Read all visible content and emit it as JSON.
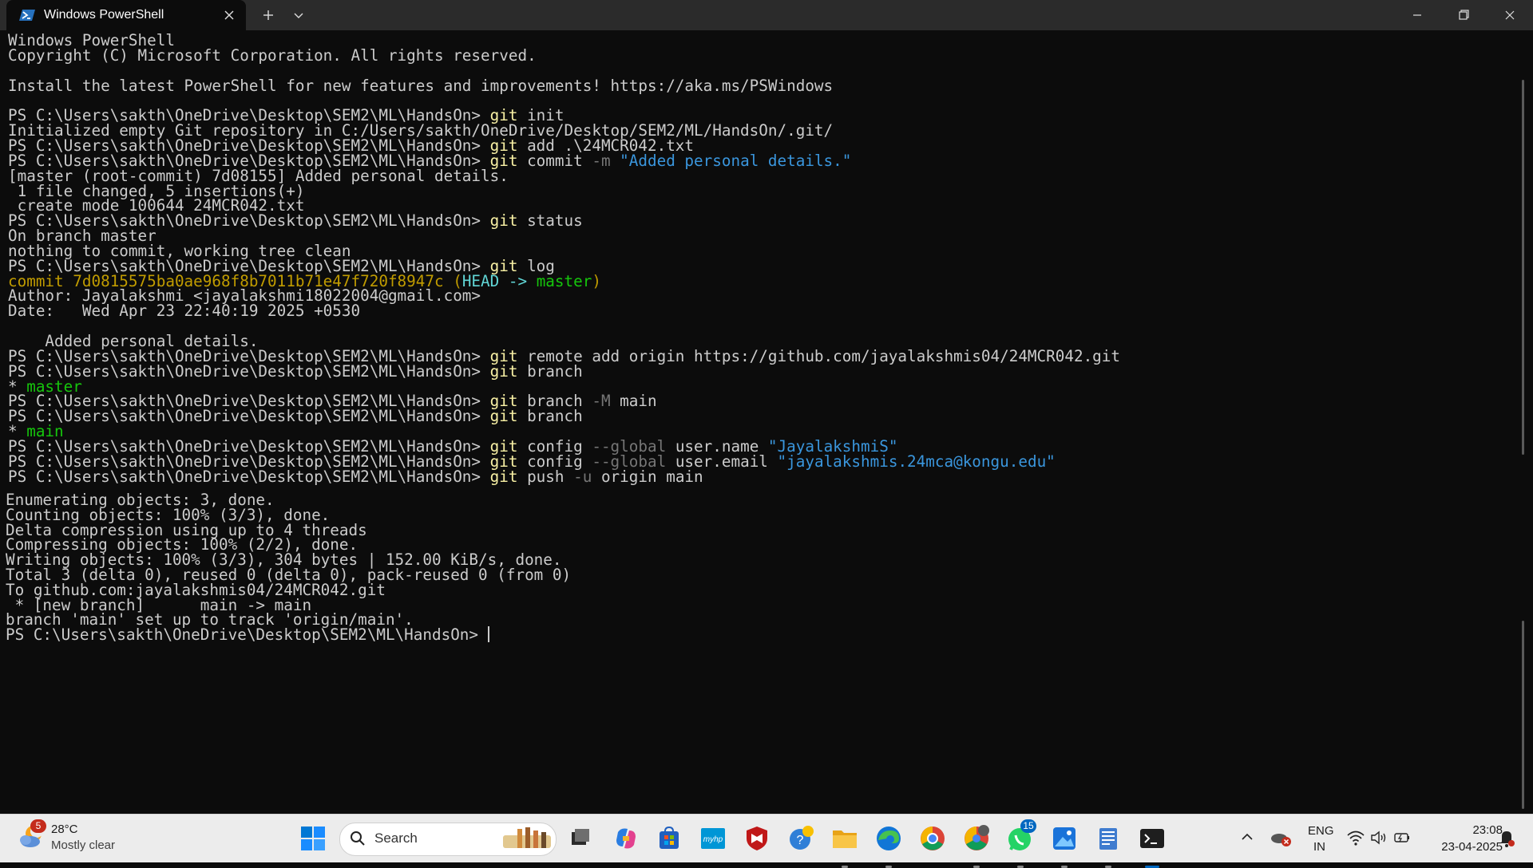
{
  "window": {
    "tab_title": "Windows PowerShell",
    "controls": [
      "minimize",
      "restore",
      "close"
    ]
  },
  "terminal": {
    "lines": [
      "Windows PowerShell",
      "Copyright (C) Microsoft Corporation. All rights reserved.",
      "",
      "Install the latest PowerShell for new features and improvements! https://aka.ms/PSWindows",
      "",
      "PS C:\\Users\\sakth\\OneDrive\\Desktop\\SEM2\\ML\\HandsOn> git init",
      "Initialized empty Git repository in C:/Users/sakth/OneDrive/Desktop/SEM2/ML/HandsOn/.git/",
      "PS C:\\Users\\sakth\\OneDrive\\Desktop\\SEM2\\ML\\HandsOn> git add .\\24MCR042.txt",
      "PS C:\\Users\\sakth\\OneDrive\\Desktop\\SEM2\\ML\\HandsOn> git commit -m \"Added personal details.\"",
      "[master (root-commit) 7d08155] Added personal details.",
      " 1 file changed, 5 insertions(+)",
      " create mode 100644 24MCR042.txt",
      "PS C:\\Users\\sakth\\OneDrive\\Desktop\\SEM2\\ML\\HandsOn> git status",
      "On branch master",
      "nothing to commit, working tree clean",
      "PS C:\\Users\\sakth\\OneDrive\\Desktop\\SEM2\\ML\\HandsOn> git log",
      "commit 7d0815575ba0ae968f8b7011b71e47f720f8947c (HEAD -> master)",
      "Author: Jayalakshmi <jayalakshmi18022004@gmail.com>",
      "Date:   Wed Apr 23 22:40:19 2025 +0530",
      "",
      "    Added personal details.",
      "PS C:\\Users\\sakth\\OneDrive\\Desktop\\SEM2\\ML\\HandsOn> git remote add origin https://github.com/jayalakshmis04/24MCR042.git",
      "PS C:\\Users\\sakth\\OneDrive\\Desktop\\SEM2\\ML\\HandsOn> git branch",
      "* master",
      "PS C:\\Users\\sakth\\OneDrive\\Desktop\\SEM2\\ML\\HandsOn> git branch -M main",
      "PS C:\\Users\\sakth\\OneDrive\\Desktop\\SEM2\\ML\\HandsOn> git branch",
      "* main",
      "PS C:\\Users\\sakth\\OneDrive\\Desktop\\SEM2\\ML\\HandsOn> git config --global user.name \"JayalakshmiS\"",
      "PS C:\\Users\\sakth\\OneDrive\\Desktop\\SEM2\\ML\\HandsOn> git config --global user.email \"jayalakshmis.24mca@kongu.edu\"",
      "PS C:\\Users\\sakth\\OneDrive\\Desktop\\SEM2\\ML\\HandsOn> git push -u origin main",
      "Enumerating objects: 3, done.",
      "Counting objects: 100% (3/3), done.",
      "Delta compression using up to 4 threads",
      "Compressing objects: 100% (2/2), done.",
      "Writing objects: 100% (3/3), 304 bytes | 152.00 KiB/s, done.",
      "Total 3 (delta 0), reused 0 (delta 0), pack-reused 0 (from 0)",
      "To github.com:jayalakshmis04/24MCR042.git",
      " * [new branch]      main -> main",
      "branch 'main' set up to track 'origin/main'.",
      "PS C:\\Users\\sakth\\OneDrive\\Desktop\\SEM2\\ML\\HandsOn> "
    ],
    "colors": {
      "background": "#0c0c0c",
      "text": "#cccccc",
      "command": "#f9f1a5",
      "operator": "#767676",
      "string": "#3a96dd",
      "commit_hash": "#c19c00",
      "head": "#61d6d6",
      "branch": "#16c60c"
    }
  },
  "taskbar": {
    "weather": {
      "temperature": "28°C",
      "description": "Mostly clear",
      "badge": "5"
    },
    "search_label": "Search",
    "apps": [
      {
        "name": "task-view",
        "icon": "task-view-icon"
      },
      {
        "name": "copilot",
        "icon": "copilot-icon"
      },
      {
        "name": "microsoft-store",
        "icon": "store-icon"
      },
      {
        "name": "myhp",
        "icon": "myhp-icon",
        "label": "myhp"
      },
      {
        "name": "mcafee",
        "icon": "mcafee-icon"
      },
      {
        "name": "get-help",
        "icon": "help-icon"
      },
      {
        "name": "file-explorer",
        "icon": "folder-icon"
      },
      {
        "name": "edge",
        "icon": "edge-icon"
      },
      {
        "name": "chrome",
        "icon": "chrome-icon"
      },
      {
        "name": "chrome-profile",
        "icon": "chrome-profile-icon"
      },
      {
        "name": "whatsapp",
        "icon": "whatsapp-icon",
        "badge": "15"
      },
      {
        "name": "photos",
        "icon": "photos-icon"
      },
      {
        "name": "notepad",
        "icon": "notepad-icon"
      },
      {
        "name": "terminal",
        "icon": "terminal-icon"
      }
    ],
    "language": {
      "line1": "ENG",
      "line2": "IN"
    },
    "clock": {
      "time": "23:08",
      "date": "23-04-2025"
    }
  }
}
